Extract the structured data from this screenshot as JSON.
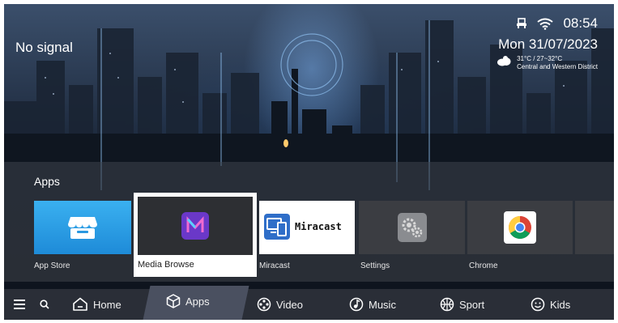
{
  "status": {
    "signal": "No signal",
    "time": "08:54",
    "date": "Mon 31/07/2023",
    "weather_temp": "31°C / 27~32°C",
    "weather_location": "Central and Western District"
  },
  "apps": {
    "title": "Apps",
    "items": [
      {
        "label": "App Store",
        "icon": "store-icon"
      },
      {
        "label": "Media Browse",
        "icon": "media-browse-icon",
        "focused": true
      },
      {
        "label": "Miracast",
        "icon": "miracast-icon",
        "logo_text": "Miracast"
      },
      {
        "label": "Settings",
        "icon": "gear-icon"
      },
      {
        "label": "Chrome",
        "icon": "chrome-icon"
      }
    ]
  },
  "nav": {
    "items": [
      {
        "label": "Home",
        "icon": "home-icon"
      },
      {
        "label": "Apps",
        "icon": "cube-icon",
        "active": true
      },
      {
        "label": "Video",
        "icon": "film-reel-icon"
      },
      {
        "label": "Music",
        "icon": "music-note-icon"
      },
      {
        "label": "Sport",
        "icon": "ball-icon"
      },
      {
        "label": "Kids",
        "icon": "smiley-icon"
      }
    ]
  },
  "colors": {
    "nav_bg": "#2a2e37",
    "nav_active_bg": "#4a5060",
    "appstore_blue": "#1e8bd8",
    "media_purple": "#7b3fd8"
  }
}
